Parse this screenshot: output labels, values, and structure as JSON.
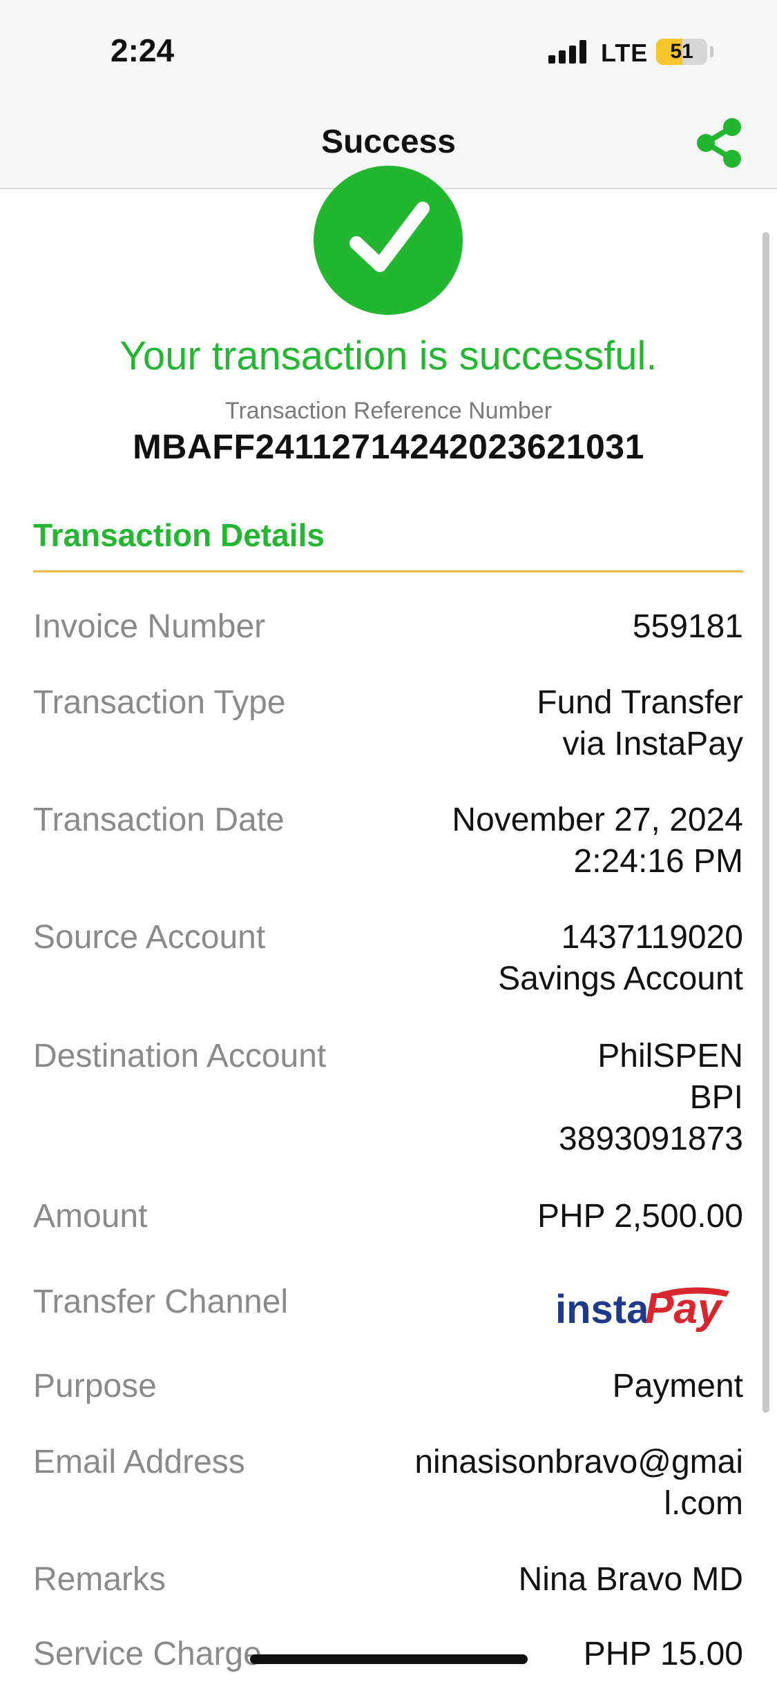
{
  "status_bar": {
    "time": "2:24",
    "network": "LTE",
    "battery": "51"
  },
  "nav": {
    "title": "Success"
  },
  "result": {
    "message": "Your transaction is successful.",
    "reference_label": "Transaction Reference Number",
    "reference_number": "MBAFF24112714242023621031"
  },
  "details": {
    "section_title": "Transaction Details",
    "invoice": {
      "label": "Invoice Number",
      "value": "559181"
    },
    "type": {
      "label": "Transaction Type",
      "value_line1": "Fund Transfer",
      "value_line2": "via InstaPay"
    },
    "date": {
      "label": "Transaction Date",
      "value_line1": "November 27, 2024",
      "value_line2": "2:24:16 PM"
    },
    "source": {
      "label": "Source Account",
      "value_line1": "1437119020",
      "value_line2": "Savings Account"
    },
    "destination": {
      "label": "Destination Account",
      "value_line1": "PhilSPEN",
      "value_line2": "BPI",
      "value_line3": "3893091873"
    },
    "amount": {
      "label": "Amount",
      "value": "PHP 2,500.00"
    },
    "channel": {
      "label": "Transfer Channel",
      "logo_text_1": "insta",
      "logo_text_2": "Pay"
    },
    "purpose": {
      "label": "Purpose",
      "value": "Payment"
    },
    "email": {
      "label": "Email Address",
      "value_line1": "ninasisonbravo@gmai",
      "value_line2": "l.com"
    },
    "remarks": {
      "label": "Remarks",
      "value": "Nina Bravo MD"
    },
    "service_charge": {
      "label": "Service Charge",
      "value": "PHP 15.00"
    }
  },
  "colors": {
    "success_green": "#22b631",
    "divider_orange": "#f5b942",
    "instapay_blue": "#1f3a8a",
    "instapay_red": "#d9262e"
  },
  "icons": {
    "share": "share-icon",
    "check": "checkmark-icon"
  }
}
